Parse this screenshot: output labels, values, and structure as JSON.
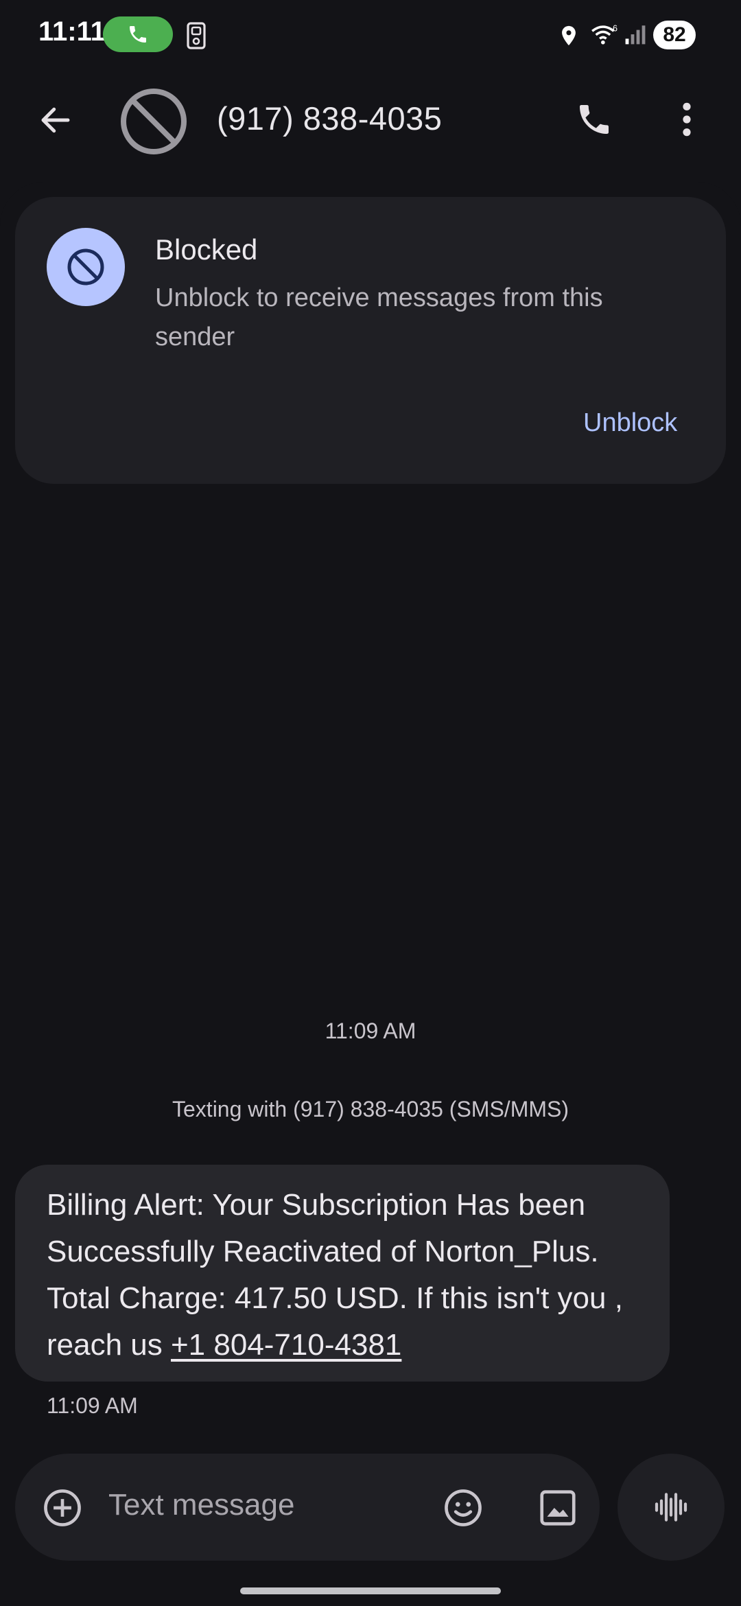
{
  "status_bar": {
    "time": "11:11",
    "battery": "82",
    "icons": [
      "phone-call-icon",
      "sim-icon",
      "location-icon",
      "wifi-icon",
      "signal-icon"
    ]
  },
  "app_bar": {
    "title": "(917) 838-4035",
    "icons": [
      "back-arrow-icon",
      "blocked-icon",
      "phone-icon",
      "more-vert-icon"
    ]
  },
  "blocked_card": {
    "title": "Blocked",
    "subtitle": "Unblock to receive messages from this sender",
    "action_label": "Unblock"
  },
  "conversation": {
    "timestamp": "11:09 AM",
    "texting_with": "Texting with (917) 838-4035 (SMS/MMS)",
    "messages": [
      {
        "text_before_link": "Billing Alert: Your Subscription Has been Successfully Reactivated of Norton_Plus. Total Charge: 417.50 USD. If this isn't you , reach us ",
        "link": "+1 804-710-4381",
        "time": "11:09 AM"
      }
    ]
  },
  "composer": {
    "placeholder": "Text message",
    "icons": [
      "add-icon",
      "emoji-icon",
      "image-icon",
      "voice-icon"
    ]
  },
  "colors": {
    "background": "#131317",
    "card": "#1f1f24",
    "bubble": "#27272c",
    "accent": "#aec2ff",
    "avatar": "#b6c5ff",
    "call_pill": "#4caf50"
  }
}
